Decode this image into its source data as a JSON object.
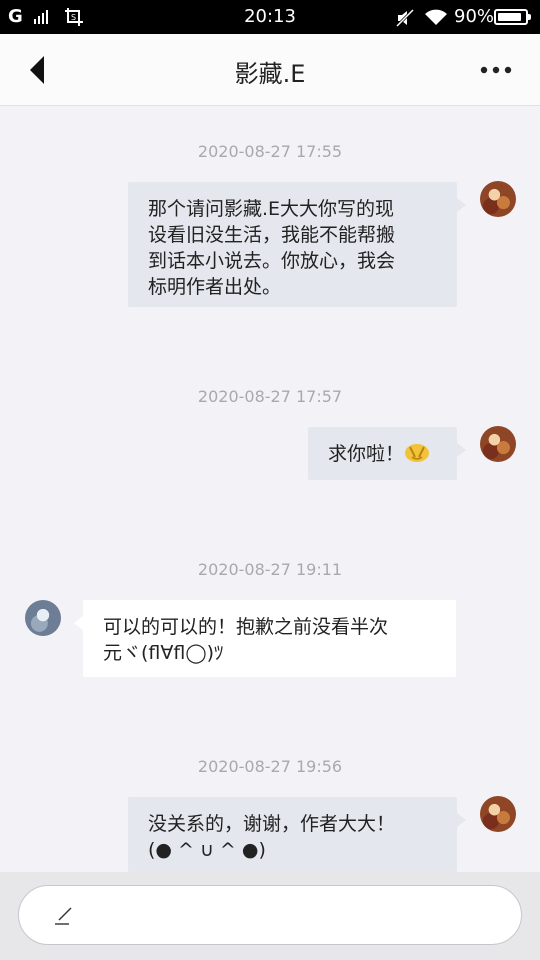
{
  "status_bar": {
    "carrier": "G",
    "time": "20:13",
    "battery_pct": "90%",
    "battery_level": 0.9,
    "icons": [
      "signal-icon",
      "screenshot-icon",
      "mute-icon",
      "wifi-icon",
      "battery-icon"
    ]
  },
  "header": {
    "title": "影藏.E",
    "icons": [
      "back-arrow-icon",
      "more-options-icon"
    ]
  },
  "messages": [
    {
      "timestamp": "2020-08-27 17:55",
      "sender": "me",
      "lines": [
        "那个请问影藏.E大大你写的现",
        "设看旧没生活，我能不能帮搬",
        "到话本小说去。你放心，我会",
        "标明作者出处。"
      ]
    },
    {
      "timestamp": "2020-08-27 17:57",
      "sender": "me",
      "text": "求你啦！",
      "emoji": "pleading-hands-emoji"
    },
    {
      "timestamp": "2020-08-27 19:11",
      "sender": "them",
      "lines": [
        "可以的可以的！抱歉之前没看半次",
        "元ヾ(ﬂ∀ﬂ◯)ﾂ"
      ]
    },
    {
      "timestamp": "2020-08-27 19:56",
      "sender": "me",
      "lines": [
        "没关系的，谢谢，作者大大！",
        "(● ^ ∪ ^ ●)"
      ]
    }
  ],
  "input": {
    "placeholder": "",
    "icon": "pen-icon"
  },
  "colors": {
    "background": "#f3f3f7",
    "my_bubble": "#e4e8ee",
    "their_bubble": "#ffffff",
    "timestamp": "#a8a8ae"
  }
}
